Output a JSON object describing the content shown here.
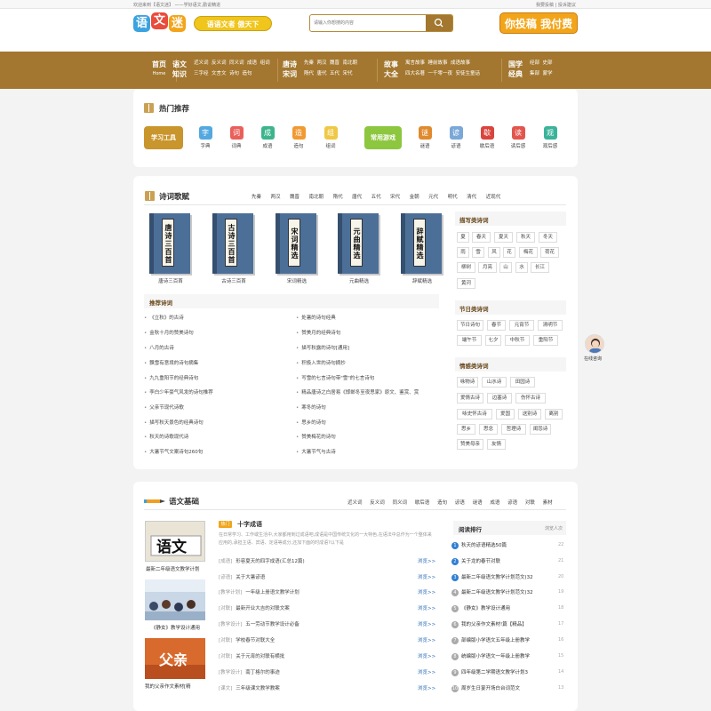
{
  "topbar": {
    "left": "欢迎来到【语文迷】 ——学好语文,勤说精进",
    "right": "我要投稿 | 投诉建议"
  },
  "header": {
    "logo_chars": [
      "语",
      "文",
      "迷"
    ],
    "slogan": "语语文者 傲天下",
    "search_placeholder": "请输入你想搜的内容",
    "contribute": "你投稿 我付费"
  },
  "nav": [
    {
      "main": "首页",
      "sub": "Home",
      "items": []
    },
    {
      "main": "语文知识",
      "sub": "",
      "items": [
        "近义词",
        "反义词",
        "同义词",
        "成语",
        "组词",
        "三字经",
        "文言文",
        "诗句",
        "造句"
      ]
    },
    {
      "main": "唐诗宋词",
      "sub": "",
      "items": [
        "先秦",
        "两汉",
        "魏晋",
        "南北朝",
        "隋代",
        "唐代",
        "五代",
        "宋代"
      ]
    },
    {
      "main": "故事大全",
      "sub": "",
      "items": [
        "寓言故事",
        "睡前故事",
        "成语故事",
        "四大名著",
        "一千零一夜",
        "安徒生童话"
      ]
    },
    {
      "main": "国学经典",
      "sub": "",
      "items": [
        "经部",
        "史部",
        "集部",
        "蒙学"
      ]
    }
  ],
  "hot": {
    "title": "热门推荐",
    "study_btn": "学习工具",
    "common_btn": "常用游戏",
    "tools": [
      "字典",
      "词典",
      "成语",
      "造句",
      "组词"
    ],
    "games": [
      "谜语",
      "谚语",
      "歇后语",
      "读后感",
      "观后感"
    ]
  },
  "poetry": {
    "title": "诗词歌赋",
    "dynasties": [
      "先秦",
      "两汉",
      "魏晋",
      "南北朝",
      "隋代",
      "唐代",
      "五代",
      "宋代",
      "金朝",
      "元代",
      "明代",
      "清代",
      "近现代"
    ],
    "books": [
      {
        "label": "唐诗三百首",
        "name": "唐诗三百首"
      },
      {
        "label": "古诗三百首",
        "name": "古诗三百首"
      },
      {
        "label": "宋词精选",
        "name": "宋词精选"
      },
      {
        "label": "元曲精选",
        "name": "元曲精选"
      },
      {
        "label": "辞赋精选",
        "name": "辞赋精选"
      }
    ],
    "rec_title": "推荐诗词",
    "rec_left": [
      "《立秋》的古诗",
      "金秋十月的赞美诗句",
      "八月的古诗",
      "飘雪有意境的诗句摘集",
      "九九重阳节的经典诗句",
      "李白少年豪气风发的诗句推荐",
      "父亲节现代诗歌",
      "描写秋天景色的经典诗句",
      "秋天的诗歌现代诗",
      "大暑节气文案诗句260句"
    ],
    "rec_right": [
      "处暑的诗句经典",
      "赞美月的经典诗句",
      "描写秋露的诗句[通用]",
      "积极入世的诗句摘抄",
      "写雪的七言诗句带\"雪\"的七言诗句",
      "精品唐诗之白居易《邯郸冬至夜思家》原文、鉴赏、赏",
      "寒冬的诗句",
      "思乡的诗句",
      "赞美梅花的诗句",
      "大暑节气与古诗"
    ]
  },
  "sidebar": {
    "describe": {
      "title": "描写类诗词",
      "tags": [
        "夏",
        "春天",
        "夏天",
        "秋天",
        "冬天",
        "雨",
        "雪",
        "风",
        "花",
        "梅花",
        "荷花",
        "柳树",
        "月亮",
        "山",
        "水",
        "长江",
        "黄河"
      ]
    },
    "festival": {
      "title": "节日类诗词",
      "tags": [
        "节日诗句",
        "春节",
        "元宵节",
        "清明节",
        "端午节",
        "七夕",
        "中秋节",
        "重阳节"
      ]
    },
    "emotion": {
      "title": "情感类诗词",
      "tags": [
        "咏物诗",
        "山水诗",
        "田园诗",
        "爱情古诗",
        "边塞诗",
        "伤怀古诗",
        "咏史怀古诗",
        "爱国",
        "送别诗",
        "离别",
        "思乡",
        "思念",
        "哲理诗",
        "闺怨诗",
        "赞美母亲",
        "友情"
      ]
    }
  },
  "float_label": "在线咨询",
  "basics": {
    "title": "语文基础",
    "tabs": [
      "近义词",
      "反义词",
      "同义词",
      "歇后语",
      "造句",
      "谚语",
      "谜语",
      "成语",
      "谚语",
      "对联",
      "素材"
    ],
    "thumbs": [
      "最新二年级语文教学计划",
      "《静女》教学设计通用",
      "我的父亲作文素材[精"
    ],
    "feature_tag": "热门",
    "feature_title": "十字成语",
    "feature_desc": "在日常学习、工作或生活中,大家都用到过成语吧,成语是中国传统文化的一大特色,在语法中总作为一个整体来应用的,承担主语、宾语、定语等成分,还加下面的时成语?以下是",
    "articles": [
      {
        "cat": "[成语]",
        "title": "形容夏天的四字成语(汇总12篇)"
      },
      {
        "cat": "[谚语]",
        "title": "关于大暑谚语"
      },
      {
        "cat": "[教学计划]",
        "title": "一年级上册语文教学计划"
      },
      {
        "cat": "[对联]",
        "title": "最新开业大吉的对联文案"
      },
      {
        "cat": "[教学设计]",
        "title": "五一劳动节教学设计必备"
      },
      {
        "cat": "[对联]",
        "title": "学校春节对联大全"
      },
      {
        "cat": "[对联]",
        "title": "关于元宵的对联有横批"
      },
      {
        "cat": "[教学设计]",
        "title": "南丁格尔的事迹"
      },
      {
        "cat": "[课文]",
        "title": "三年级课文教学教案"
      }
    ],
    "more": "浏览>>",
    "rank_title": "阅读排行",
    "rank_more": "浏览人次",
    "rank": [
      {
        "t": "秋天的谚语精选50篇",
        "n": "22"
      },
      {
        "t": "关于龙的春节对联",
        "n": "21"
      },
      {
        "t": "最新二年级语文教学计划范文(32",
        "n": "20"
      },
      {
        "t": "最新二年级语文教学计划范文(32",
        "n": "19"
      },
      {
        "t": "《静女》教学设计通用",
        "n": "18"
      },
      {
        "t": "我的父亲作文素材!篇【精品】",
        "n": "17"
      },
      {
        "t": "部编版小学语文五年级上册教学",
        "n": "16"
      },
      {
        "t": "统编版小学语文一年级上册教学",
        "n": "15"
      },
      {
        "t": "四年级第二学期语文教学计划3",
        "n": "14"
      },
      {
        "t": "周岁生日宴开场白台词范文",
        "n": "13"
      }
    ]
  },
  "colors": {
    "brand": "#a3772f",
    "accent": "#f2a51a",
    "link": "#2e6fb8"
  }
}
